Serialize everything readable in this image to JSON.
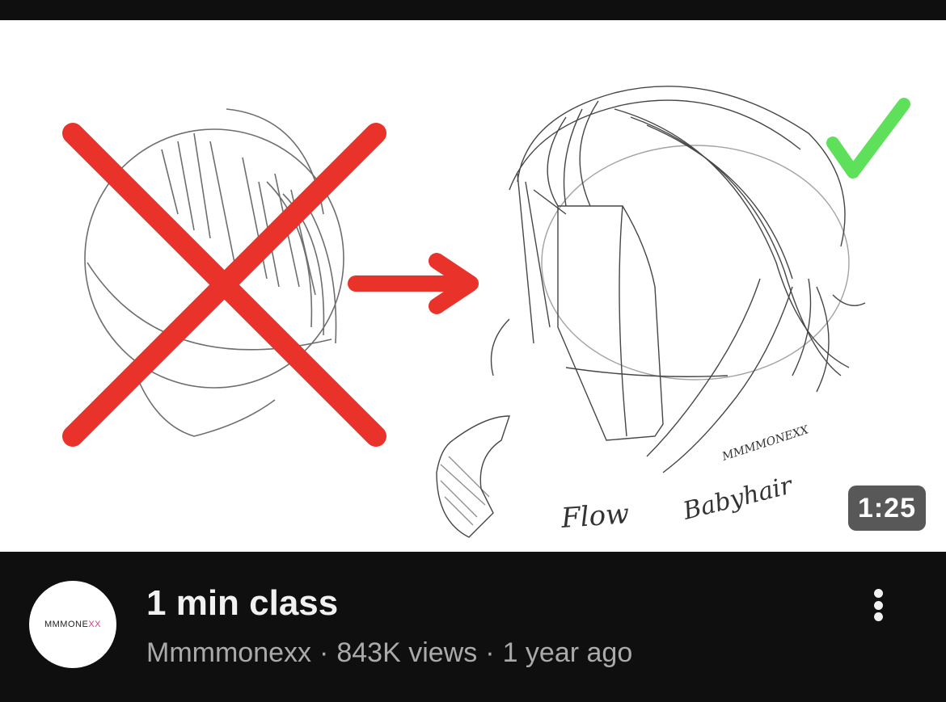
{
  "video": {
    "duration": "1:25",
    "title": "1 min class",
    "channel": "Mmmmonexx",
    "views": "843K views",
    "age": "1 year ago",
    "separator": "·"
  },
  "avatar": {
    "logo_text_a": "MMMONE",
    "logo_text_b": "XX"
  },
  "thumbnail": {
    "handwriting_1": "Flow",
    "handwriting_2": "Babyhair",
    "signature": "MMMMONEXX",
    "wrong_mark_color": "#e8322a",
    "right_mark_color": "#5ee05a",
    "arrow_color": "#e8322a"
  },
  "icons": {
    "more": "more-vertical-icon",
    "wrong": "x-cross-icon",
    "right": "checkmark-icon",
    "arrow": "arrow-right-icon"
  }
}
